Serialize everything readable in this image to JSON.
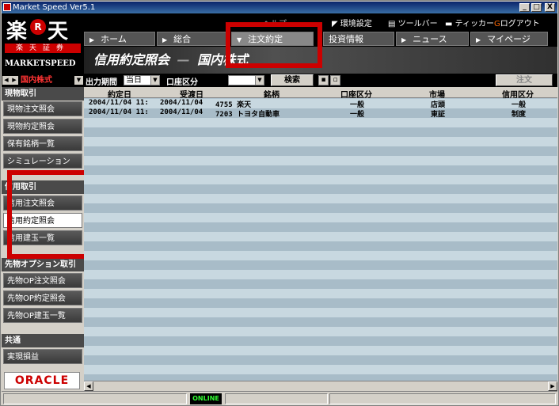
{
  "window": {
    "title": "Market Speed Ver5.1",
    "controls": [
      "_",
      "□",
      "X"
    ]
  },
  "logo": {
    "kanji": "楽",
    "r": "R",
    "kanji2": "天",
    "securities": "楽天証券",
    "brand": "MARKETSPEED"
  },
  "toplinks": {
    "partial": "・ヘルプ",
    "env": "環境設定",
    "toolbar": "ツールバー",
    "ticker": "ティッカー",
    "logout": "ログアウト"
  },
  "nav": {
    "home": "ホーム",
    "sogo": "総合",
    "orders": "注文約定",
    "info": "投資情報",
    "news": "ニュース",
    "mypage": "マイページ"
  },
  "page_title": {
    "main": "信用約定照会",
    "sep": "—",
    "sub": "国内株式"
  },
  "market_select": "国内株式",
  "toolbar": {
    "period_label": "出力期間",
    "period_value": "当日",
    "account_label": "口座区分",
    "account_value": "",
    "search_button": "検索",
    "order_button": "注文"
  },
  "sidebar": {
    "sections": [
      {
        "title": "現物取引",
        "items": [
          "現物注文照会",
          "現物約定照会",
          "保有銘柄一覧",
          "シミュレーション"
        ]
      },
      {
        "title": "信用取引",
        "items": [
          "信用注文照会",
          "信用約定照会",
          "信用建玉一覧"
        ]
      },
      {
        "title": "先物オプション取引",
        "items": [
          "先物OP注文照会",
          "先物OP約定照会",
          "先物OP建玉一覧"
        ]
      },
      {
        "title": "共通",
        "items": [
          "実現損益"
        ]
      }
    ],
    "oracle": "ORACLE"
  },
  "table": {
    "headers": [
      "約定日",
      "受渡日",
      "銘柄",
      "口座区分",
      "市場",
      "信用区分"
    ],
    "rows": [
      [
        "2004/11/04 11:",
        "2004/11/04",
        "4755 楽天",
        "一般",
        "店頭",
        "一般"
      ],
      [
        "2004/11/04 11:",
        "2004/11/04",
        "7203 トヨタ自動車",
        "一般",
        "東証",
        "制度"
      ]
    ]
  },
  "status": {
    "online": "ONLINE"
  },
  "colors": {
    "highlight": "#cc0000",
    "grid_a": "#c8d8e0",
    "grid_b": "#a8bcc8"
  }
}
